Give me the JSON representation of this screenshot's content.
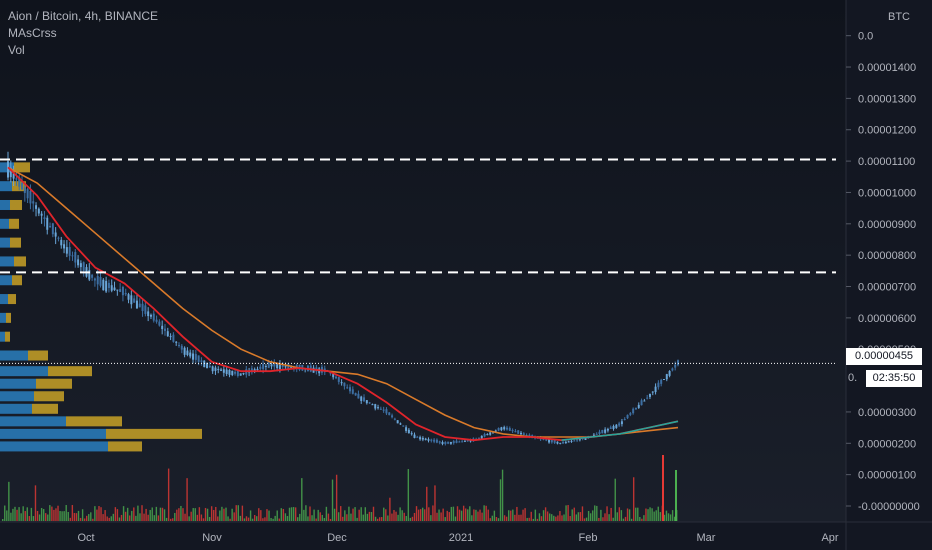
{
  "legend": {
    "title": "Aion / Bitcoin, 4h, BINANCE",
    "indicator1": "MAsCrss",
    "indicator2": "Vol"
  },
  "price_axis": {
    "currency": "BTC",
    "ticks": [
      "0.0",
      "0.00001400",
      "0.00001300",
      "0.00001200",
      "0.00001100",
      "0.00001000",
      "0.00000900",
      "0.00000800",
      "0.00000700",
      "0.00000600",
      "0.00000500",
      "0.00000300",
      "0.00000200",
      "0.00000100",
      "-0.00000000"
    ],
    "current_price_label": "0.00000455",
    "countdown_label": "02:35:50",
    "partial_label": "0."
  },
  "time_axis": {
    "labels": [
      "Oct",
      "Nov",
      "Dec",
      "2021",
      "Feb",
      "Mar",
      "Apr"
    ]
  },
  "colors": {
    "background": "#131722",
    "fast_ma": "#e0242b",
    "slow_ma": "#d97a2a",
    "cross_segment": "#26a69a",
    "candles": "#5b8fc7",
    "levels": "#ffffff",
    "vol_up": "#4caf50",
    "vol_down": "#e53935",
    "vp_buy": "#2a7fc0",
    "vp_sell": "#c9a227"
  },
  "chart_data": {
    "type": "line",
    "title": "Aion / Bitcoin, 4h, BINANCE",
    "xlabel": "",
    "ylabel": "",
    "x_labels": [
      "Oct",
      "Nov",
      "Dec",
      "2021",
      "Feb",
      "Mar",
      "Apr"
    ],
    "ylim": [
      0,
      1.55e-05
    ],
    "horizontal_levels": [
      1.105e-05,
      7.45e-06,
      4.55e-06
    ],
    "series": [
      {
        "name": "",
        "values": [
          1.08e-05,
          9.5e-06,
          8.2e-06,
          7.2e-06,
          6.8e-06,
          6e-06,
          5e-06,
          4.4e-06,
          4.2e-06,
          4.5e-06,
          4.4e-06,
          4.3e-06,
          3.5e-06,
          3e-06,
          2.2e-06,
          2e-06,
          2.1e-06,
          2.5e-06,
          2.2e-06,
          2e-06,
          2.2e-06,
          2.6e-06,
          3.5e-06,
          4.55e-06
        ]
      },
      {
        "name": "",
        "values": [
          1.08e-05,
          9.9e-06,
          8.6e-06,
          7.6e-06,
          7.1e-06,
          6.3e-06,
          5.4e-06,
          4.6e-06,
          4.3e-06,
          4.3e-06,
          4.4e-06,
          4.3e-06,
          3.9e-06,
          3.3e-06,
          2.6e-06,
          2.2e-06,
          2.1e-06,
          2.2e-06,
          2.2e-06,
          2.1e-06,
          2.2e-06,
          2.3e-06,
          2.5e-06,
          2.7e-06
        ]
      },
      {
        "name": "",
        "values": [
          1.08e-05,
          1.03e-05,
          9.5e-06,
          8.7e-06,
          7.9e-06,
          7.1e-06,
          6.3e-06,
          5.6e-06,
          5e-06,
          4.6e-06,
          4.4e-06,
          4.3e-06,
          4.2e-06,
          3.9e-06,
          3.4e-06,
          2.9e-06,
          2.5e-06,
          2.3e-06,
          2.2e-06,
          2.2e-06,
          2.2e-06,
          2.3e-06,
          2.4e-06,
          2.5e-06
        ]
      }
    ],
    "volume_profile": [
      {
        "buy": 14,
        "sell": 16,
        "price": 1.08e-05
      },
      {
        "buy": 12,
        "sell": 14,
        "price": 1.02e-05
      },
      {
        "buy": 10,
        "sell": 12,
        "price": 9.6e-06
      },
      {
        "buy": 9,
        "sell": 10,
        "price": 9e-06
      },
      {
        "buy": 10,
        "sell": 11,
        "price": 8.4e-06
      },
      {
        "buy": 14,
        "sell": 12,
        "price": 7.8e-06
      },
      {
        "buy": 12,
        "sell": 10,
        "price": 7.2e-06
      },
      {
        "buy": 8,
        "sell": 8,
        "price": 6.6e-06
      },
      {
        "buy": 6,
        "sell": 5,
        "price": 6e-06
      },
      {
        "buy": 5,
        "sell": 5,
        "price": 5.4e-06
      },
      {
        "buy": 28,
        "sell": 20,
        "price": 4.8e-06
      },
      {
        "buy": 48,
        "sell": 44,
        "price": 4.3e-06
      },
      {
        "buy": 36,
        "sell": 36,
        "price": 3.9e-06
      },
      {
        "buy": 34,
        "sell": 30,
        "price": 3.5e-06
      },
      {
        "buy": 32,
        "sell": 26,
        "price": 3.1e-06
      },
      {
        "buy": 66,
        "sell": 56,
        "price": 2.7e-06
      },
      {
        "buy": 106,
        "sell": 96,
        "price": 2.3e-06
      },
      {
        "buy": 108,
        "sell": 34,
        "price": 1.9e-06
      }
    ]
  }
}
